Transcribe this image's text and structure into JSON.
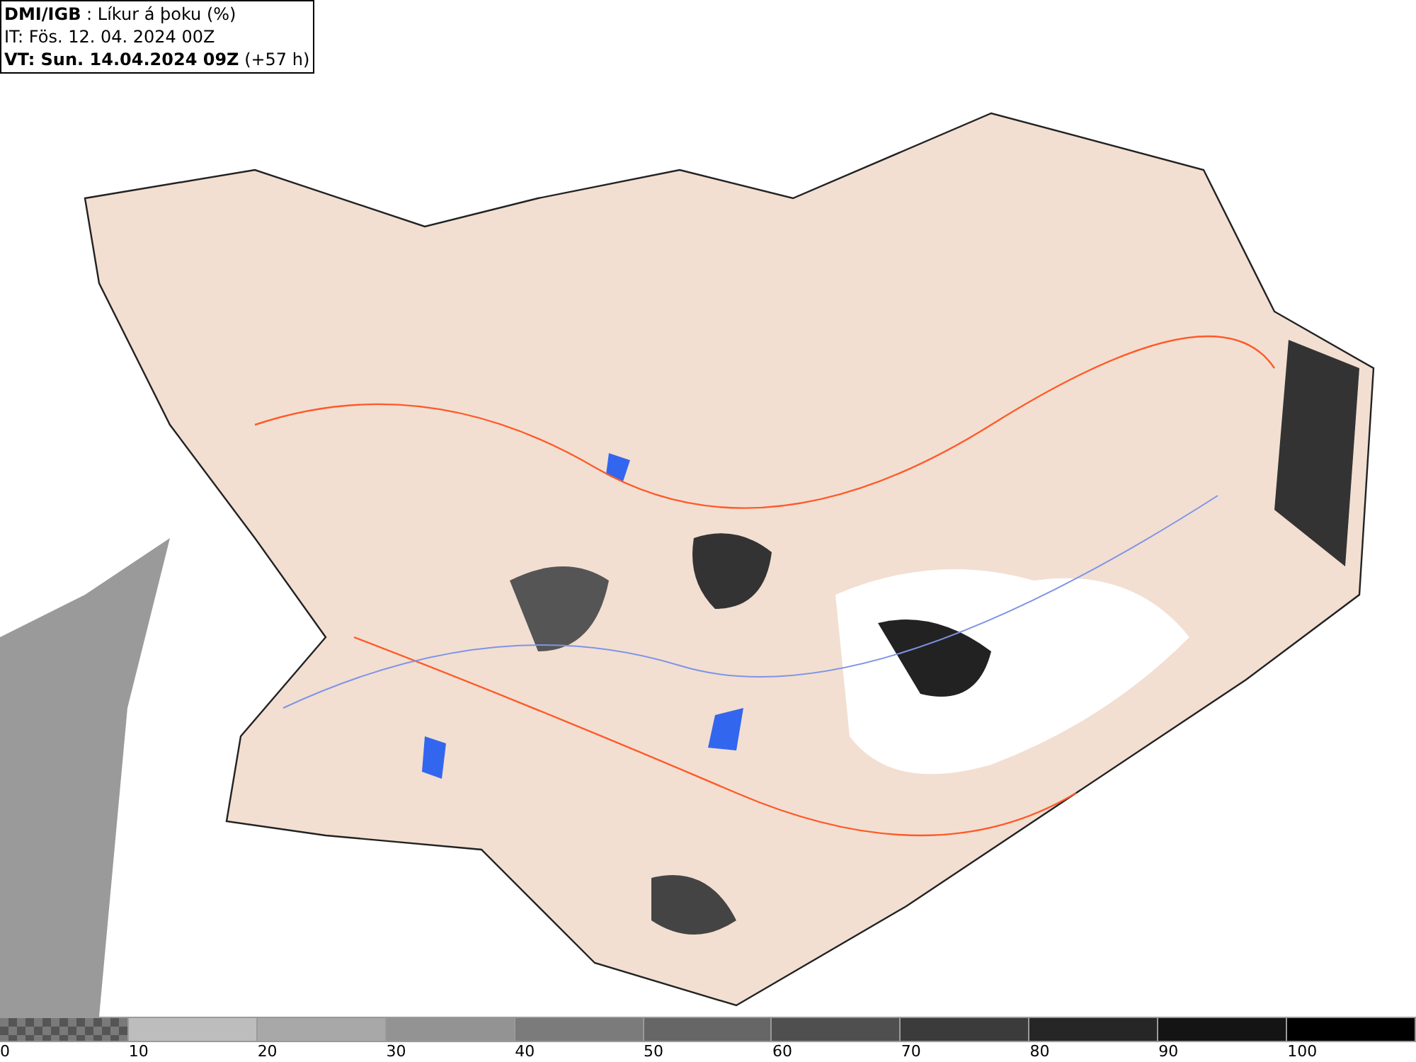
{
  "header": {
    "lines": [
      "**DMI/IGB** : Líkur á þoku (%)",
      "IT: Fös. 12. 04. 2024 00Z",
      "**VT: Sun. 14.04.2024 09Z** (+57 h)"
    ]
  },
  "legend": {
    "segments": [
      {
        "kind": "pattern",
        "color": "#7a7a7a"
      },
      {
        "kind": "solid",
        "color": "#bdbdbd"
      },
      {
        "kind": "solid",
        "color": "#a8a8a8"
      },
      {
        "kind": "solid",
        "color": "#939393"
      },
      {
        "kind": "solid",
        "color": "#7b7b7b"
      },
      {
        "kind": "solid",
        "color": "#666666"
      },
      {
        "kind": "solid",
        "color": "#4f4f4f"
      },
      {
        "kind": "solid",
        "color": "#3b3b3b"
      },
      {
        "kind": "solid",
        "color": "#262626"
      },
      {
        "kind": "solid",
        "color": "#141414"
      },
      {
        "kind": "solid",
        "color": "#000000"
      }
    ],
    "labels": [
      "0",
      "10",
      "20",
      "30",
      "40",
      "50",
      "60",
      "70",
      "80",
      "90",
      "100"
    ]
  }
}
